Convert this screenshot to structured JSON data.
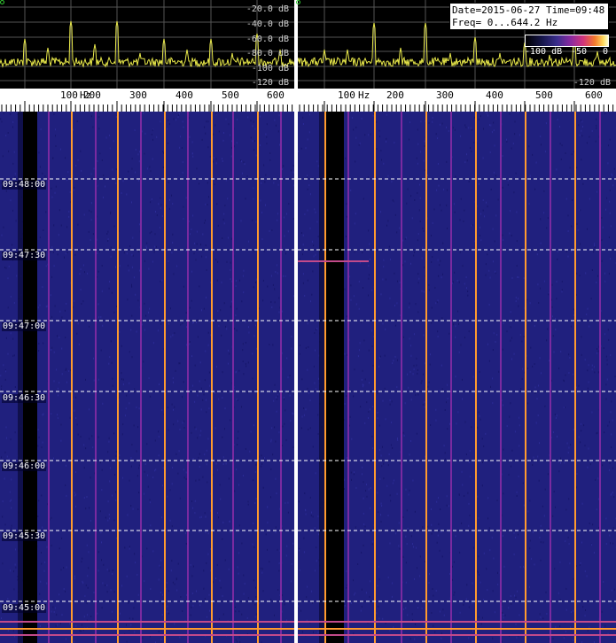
{
  "colors": {
    "background": "#1a1a7a",
    "trace": "#e8e84a",
    "orange_line": "#ff9a2e",
    "purple_line": "#7a2aa0",
    "dark_band": "#000000"
  },
  "spectrum": {
    "db_labels": [
      "-20.0 dB",
      "-40.0 dB",
      "-60.0 dB",
      "-80.0 dB",
      "-100 dB",
      "-120 dB"
    ]
  },
  "axis": {
    "left_labels": [
      "100",
      "Hz",
      "200",
      "300",
      "400",
      "500",
      "600"
    ],
    "right_labels": [
      "100",
      "Hz",
      "200",
      "300",
      "400",
      "500",
      "600"
    ]
  },
  "info": {
    "line1": "Date=2015-06-27 Time=09:48",
    "line2": "Freq= 0...644.2 Hz"
  },
  "colorbar": {
    "left_label": "-100 dB",
    "mid_label": "-50",
    "right_label": "0"
  },
  "waterfall": {
    "time_labels": [
      "09:48:00",
      "09:47:30",
      "09:47:00",
      "09:46:30",
      "09:46:00",
      "09:45:30",
      "09:45:00"
    ]
  }
}
